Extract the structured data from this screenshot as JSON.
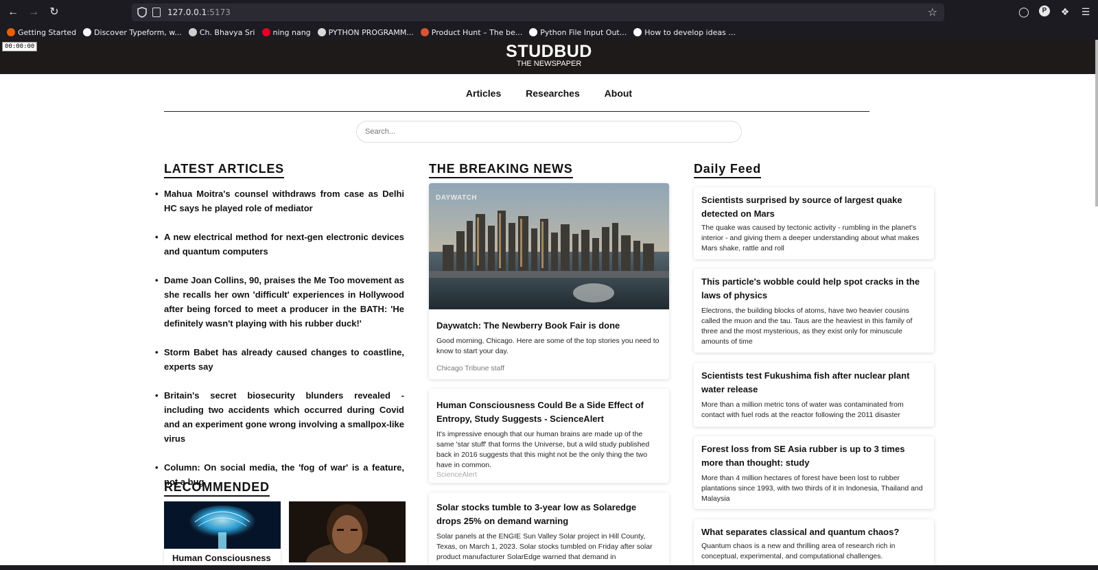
{
  "browser": {
    "url_host": "127.0.0.1",
    "url_port": ":5173",
    "icons": {
      "back": "back-arrow-icon",
      "forward": "forward-arrow-icon",
      "reload": "reload-icon",
      "star": "star-icon",
      "pocket": "pocket-icon",
      "profile": "P",
      "extensions": "extensions-icon",
      "menu": "hamburger-menu-icon"
    },
    "bookmarks": [
      {
        "label": "Getting Started",
        "color": "#e66000"
      },
      {
        "label": "Discover Typeform, w...",
        "color": "#f4f4f4"
      },
      {
        "label": "Ch. Bhavya Sri",
        "color": "#cfcfcf"
      },
      {
        "label": "ning nang",
        "color": "#e60023"
      },
      {
        "label": "PYTHON PROGRAMM...",
        "color": "#d9d9d9"
      },
      {
        "label": "Product Hunt – The be...",
        "color": "#da552f"
      },
      {
        "label": "Python File Input Out...",
        "color": "#ffffff"
      },
      {
        "label": "How to develop ideas ...",
        "color": "#ffffff"
      }
    ]
  },
  "timer": "00:00:00",
  "site": {
    "brand": "STUDBUD",
    "tagline": "THE NEWSPAPER",
    "nav": [
      "Articles",
      "Researches",
      "About"
    ],
    "search_placeholder": "Search..."
  },
  "latest": {
    "heading": "LATEST ARTICLES",
    "items": [
      "Mahua Moitra's counsel withdraws from case as Delhi HC says he played role of mediator",
      "A new electrical method for next-gen electronic devices and quantum computers",
      "Dame Joan Collins, 90, praises the Me Too movement as she recalls her own 'difficult' experiences in Hollywood after being forced to meet a producer in the BATH: 'He definitely wasn't playing with his rubber duck!'",
      "Storm Babet has already caused changes to coastline, experts say",
      "Britain's secret biosecurity blunders revealed - including two accidents which occurred during Covid and an experiment gone wrong involving a smallpox-like virus",
      "Column: On social media, the 'fog of war' is a feature, not a bug"
    ]
  },
  "recommended": {
    "heading": "RECOMMENDED",
    "first_card_title": "Human Consciousness"
  },
  "breaking": {
    "heading": "THE BREAKING NEWS",
    "image_watermark": "DAYWATCH",
    "cards": [
      {
        "title": "Daywatch: The Newberry Book Fair is done",
        "desc": "Good morning, Chicago. Here are some of the top stories you need to know to start your day.",
        "source": "Chicago Tribune staff"
      },
      {
        "title": "Human Consciousness Could Be a Side Effect of Entropy, Study Suggests - ScienceAlert",
        "desc": "It's impressive enough that our human brains are made up of the same 'star stuff' that forms the Universe, but a wild study published back in 2016 suggests that this might not be the only thing the two have in common.",
        "source": "ScienceAlert"
      },
      {
        "title": "Solar stocks tumble to 3-year low as Solaredge drops 25% on demand warning",
        "desc": "Solar panels at the ENGIE Sun Valley Solar project in Hill County, Texas, on March 1, 2023. Solar stocks tumbled on Friday after solar product manufacturer SolarEdge warned that demand in",
        "source": ""
      }
    ]
  },
  "daily": {
    "heading": "Daily Feed",
    "cards": [
      {
        "title": "Scientists surprised by source of largest quake detected on Mars",
        "desc": "The quake was caused by tectonic activity - rumbling in the planet's interior - and giving them a deeper understanding about what makes Mars shake, rattle and roll"
      },
      {
        "title": "This particle's wobble could help spot cracks in the laws of physics",
        "desc": "Electrons, the building blocks of atoms, have two heavier cousins called the muon and the tau. Taus are the heaviest in this family of three and the most mysterious, as they exist only for minuscule amounts of time"
      },
      {
        "title": "Scientists test Fukushima fish after nuclear plant water release",
        "desc": "More than a million metric tons of water was contaminated from contact with fuel rods at the reactor following the 2011 disaster"
      },
      {
        "title": "Forest loss from SE Asia rubber is up to 3 times more than thought: study",
        "desc": "More than 4 million hectares of forest have been lost to rubber plantations since 1993, with two thirds of it in Indonesia, Thailand and Malaysia"
      },
      {
        "title": "What separates classical and quantum chaos?",
        "desc": "Quantum chaos is a new and thrilling area of research rich in conceptual, experimental, and computational challenges."
      }
    ]
  }
}
